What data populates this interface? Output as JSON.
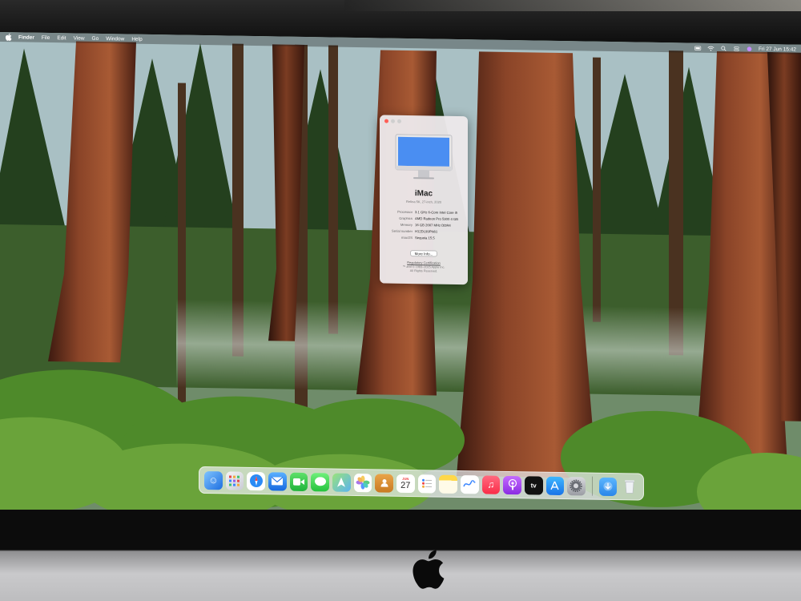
{
  "menubar": {
    "items": [
      "Finder",
      "File",
      "Edit",
      "View",
      "Go",
      "Window",
      "Help"
    ],
    "clock": "Fri 27 Jun  15:42"
  },
  "about": {
    "title": "iMac",
    "subtitle": "Retina 5K, 27-inch, 2020",
    "specs": [
      {
        "key": "Processor",
        "value": "3.1 GHz 6-Core Intel Core i5"
      },
      {
        "key": "Graphics",
        "value": "AMD Radeon Pro 5300 4 GB"
      },
      {
        "key": "Memory",
        "value": "16 GB 2667 MHz DDR4"
      },
      {
        "key": "Serial number",
        "value": "H12DL99PN61"
      },
      {
        "key": "macOS",
        "value": "Sequoia 15.5"
      }
    ],
    "more_info_label": "More Info...",
    "regulatory_label": "Regulatory Certification",
    "copyright_line1": "™ and © 1983–2025 Apple Inc.",
    "copyright_line2": "All Rights Reserved."
  },
  "dock": {
    "calendar_month": "JUN",
    "calendar_day": "27",
    "tv_label": "tv"
  },
  "colors": {
    "desktop_top": "#9fb4b8",
    "desktop_bottom": "#5f8f32",
    "trunk": "#7a3a22",
    "close": "#ff5f57",
    "minimize": "#c9c9c9"
  }
}
